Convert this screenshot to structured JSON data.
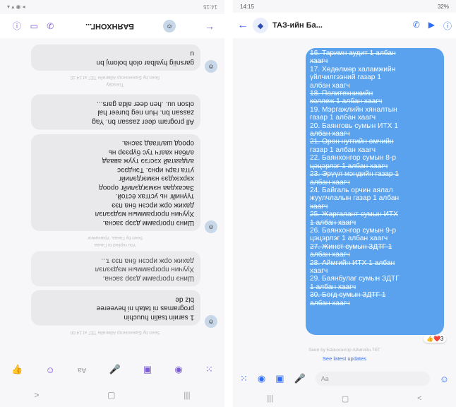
{
  "left": {
    "status_time": "14:15",
    "contact_name": "БАЯНХОНГ...",
    "messages": [
      {
        "text": "garsniig hyalbar oloh bolomj bn\nu",
        "meta": "Seen by Баянхонгор Аймгийн ТЕГ at 14:15"
      },
      {
        "text": "All program deer zassan bn. Yag\nzassan bn. Hun neg bureer hal\nolson uu. .hen deer alda gars...",
        "meta": "Tuesday"
      },
      {
        "text": "Шинэ программ дээр засна.\nХуучин программын мэдээлэл\nдахиж орж ирсэн бна пээ\nтүүнийг нь устгах ёстой.\nЗасахдаа нэмэгдэлийг ороод\nхэрхэхдээ нэмэгдэлийг\nутга гарч ирнэ. Тэндээс\nалдаатай хэсгээ тууж аваад\nалбан хаагч тус бүрээр нь\nороод шалгаад засна.",
        "meta": "Seen by Ганаа, Уранчимэг"
      },
      {
        "text": "Шинэ программ дээр засна.\nХуучин программын мэдээлэл\nдахиж орж ирсэн бна пээ т...",
        "meta": "You replied to Ганаа"
      },
      {
        "text": "1 sarиin tsalin huuchin\nprogramas ni tatah ni heveeree\nbiz de",
        "meta": "Seen by Баянхонгор Аймгийн ТЕГ at 14:00"
      }
    ],
    "composer_placeholder": "Aa"
  },
  "right": {
    "status_time": "14:15",
    "battery": "32%",
    "contact_name": "ТАЗ-ийн Ба...",
    "message_lines": [
      {
        "text": "16. Таримн аудит 1 албан",
        "struck": true
      },
      {
        "text": "хаагч",
        "struck": true
      },
      {
        "text": "17. Хөдөлмөр халамжийн",
        "struck": false
      },
      {
        "text": "үйлчилгээний газар 1",
        "struck": false
      },
      {
        "text": "албан хаагч",
        "struck": false
      },
      {
        "text": "18. Политехникийн",
        "struck": true
      },
      {
        "text": "коллеж 1 албан хаагч",
        "struck": true
      },
      {
        "text": "19. Мэргажлийн хяналтын",
        "struck": false
      },
      {
        "text": "газар 1 албан хаагч",
        "struck": false
      },
      {
        "text": "20. Баянговь сумын ИТХ 1",
        "struck": false
      },
      {
        "text": "албан хаагч",
        "struck": true
      },
      {
        "text": "21. Орон нутгийн өмчийн",
        "struck": true
      },
      {
        "text": "газар 1 албан хаагч",
        "struck": false
      },
      {
        "text": "22. Баянхонгор сумын 8-р",
        "struck": false
      },
      {
        "text": "цэцэрлэг 1 албан хаагч",
        "struck": true
      },
      {
        "text": "23. Эрүүл мэндийн газар 1",
        "struck": true
      },
      {
        "text": "албан хаагч",
        "struck": true
      },
      {
        "text": "24. Байгаль орчин аялал",
        "struck": false
      },
      {
        "text": "жуулчлалын газар 1 албан",
        "struck": false
      },
      {
        "text": "хаагч",
        "struck": true
      },
      {
        "text": "25. Жаргалант сумын ИТХ",
        "struck": true
      },
      {
        "text": "1 албан хаагч",
        "struck": true
      },
      {
        "text": "26. Баянхонгор сумын 9-р",
        "struck": false
      },
      {
        "text": "цэцэрлэг 1 албан хаагч",
        "struck": false
      },
      {
        "text": "27. Жинст сумын ЗДТГ 1",
        "struck": true
      },
      {
        "text": "албан хаагч",
        "struck": true
      },
      {
        "text": "28. Аймгийн ИТХ 1 албан",
        "struck": true
      },
      {
        "text": "хаагч",
        "struck": false
      },
      {
        "text": "29. Баянбулаг сумын ЗДТГ",
        "struck": false
      },
      {
        "text": "1 албан хаагч",
        "struck": true
      },
      {
        "text": "30. Богд сумын ЗДТГ 1",
        "struck": true
      },
      {
        "text": "албан хаагч",
        "struck": true
      }
    ],
    "reaction": "👍❤️3",
    "seen_text": "Seen by Баянхонгор Аймгийн ТЕГ",
    "link_text": "See latest updates",
    "composer_placeholder": "Aa"
  }
}
